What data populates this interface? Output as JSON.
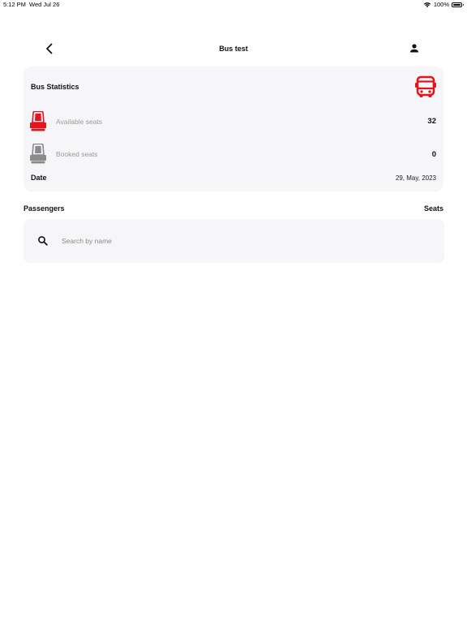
{
  "status_bar": {
    "time": "5:12 PM",
    "date": "Wed Jul 26",
    "battery": "100%"
  },
  "nav": {
    "title": "Bus test",
    "icons": {
      "back": "chevron-left-icon",
      "profile": "person-icon"
    }
  },
  "stats": {
    "title": "Bus Statistics",
    "available_label": "Available seats",
    "available_value": "32",
    "booked_label": "Booked seats",
    "booked_value": "0",
    "date_label": "Date",
    "date_value": "29, May, 2023",
    "icons": {
      "bus": "bus-icon",
      "available": "seat-icon",
      "booked": "seat-icon"
    }
  },
  "passengers": {
    "title": "Passengers",
    "seats_header": "Seats",
    "search_placeholder": "Search by name",
    "search_value": ""
  },
  "colors": {
    "accent": "#e4161d",
    "booked_seat": "#8b8b8b",
    "card_bg": "#f6f6f8",
    "muted_text": "#9a9a9a"
  }
}
